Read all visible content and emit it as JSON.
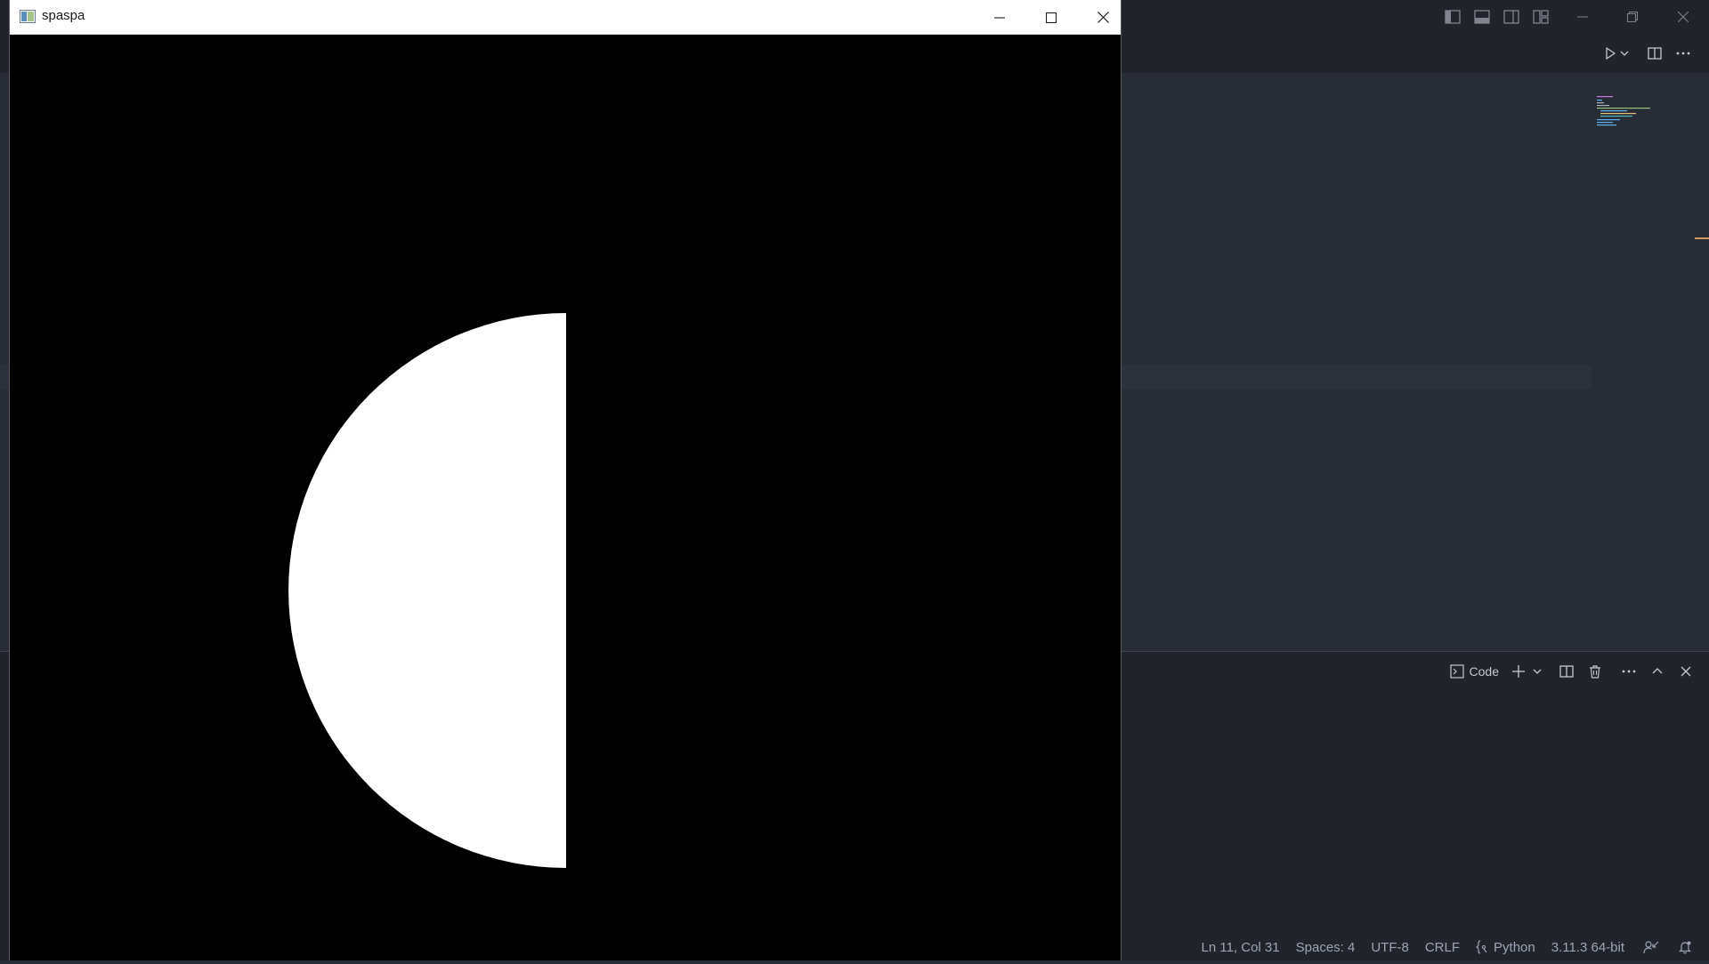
{
  "python_window": {
    "title": "spaspa",
    "controls": {
      "minimize": "minimize-icon",
      "maximize": "maximize-icon",
      "close": "close-icon"
    },
    "canvas": {
      "background": "#000000",
      "shape_color": "#ffffff",
      "shape": "half-disc"
    }
  },
  "vscode": {
    "panel_toolbar": {
      "terminal_profile_label": "Code"
    },
    "statusbar": {
      "cursor_position": "Ln 11, Col 31",
      "indentation": "Spaces: 4",
      "encoding": "UTF-8",
      "line_ending": "CRLF",
      "language": "Python",
      "interpreter": "3.11.3 64-bit"
    },
    "colors": {
      "editor_bg": "#282c34",
      "chrome_bg": "#21252b",
      "accent": "#d19a66"
    }
  }
}
